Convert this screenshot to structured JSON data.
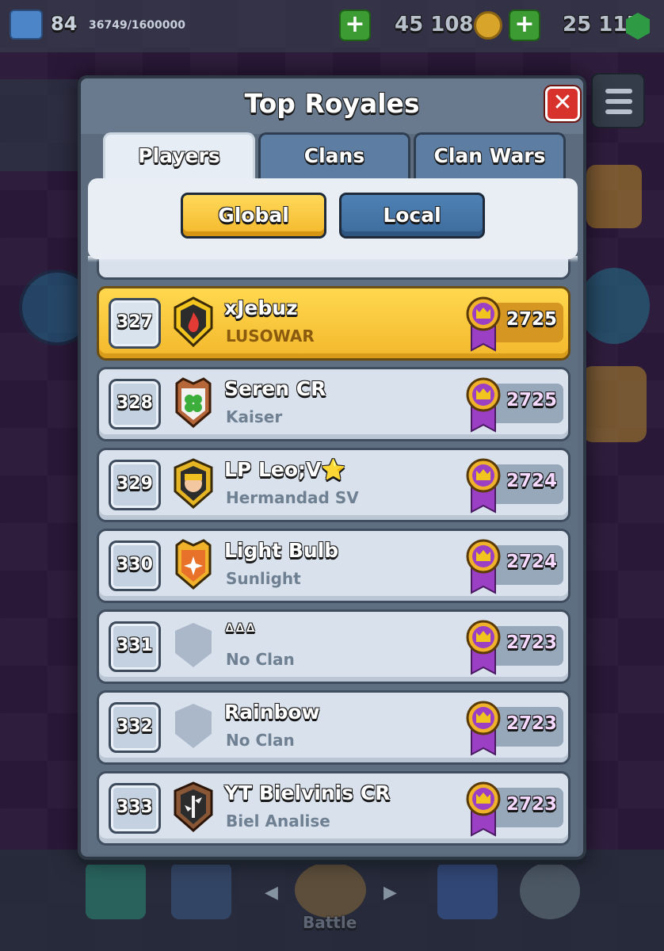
{
  "topbar": {
    "level": "84",
    "xp": "36749/1600000",
    "gold": "45 108",
    "gems": "25 117",
    "plus_label": "+"
  },
  "modal": {
    "title": "Top Royales",
    "close_label": "✕",
    "tabs": [
      {
        "label": "Players",
        "active": true
      },
      {
        "label": "Clans",
        "active": false
      },
      {
        "label": "Clan Wars",
        "active": false
      }
    ],
    "filters": {
      "global": "Global",
      "local": "Local",
      "selected": "Global"
    }
  },
  "rows": [
    {
      "rank": "327",
      "name": "xJebuz",
      "clan": "LUSOWAR",
      "trophies": "2725",
      "highlight": true,
      "badge": "flame-badge-icon"
    },
    {
      "rank": "328",
      "name": "Seren CR",
      "clan": "Kaiser",
      "trophies": "2725",
      "highlight": false,
      "badge": "clover-badge-icon"
    },
    {
      "rank": "329",
      "name": "LP Leo;V⭐",
      "clan": "Hermandad SV",
      "trophies": "2724",
      "highlight": false,
      "badge": "knight-badge-icon"
    },
    {
      "rank": "330",
      "name": "Light Bulb",
      "clan": "Sunlight",
      "trophies": "2724",
      "highlight": false,
      "badge": "star-badge-icon"
    },
    {
      "rank": "331",
      "name": "ᐞᐞᐞ",
      "clan": "No Clan",
      "trophies": "2723",
      "highlight": false,
      "badge": "no-clan-badge-icon"
    },
    {
      "rank": "332",
      "name": "Rainbow",
      "clan": "No Clan",
      "trophies": "2723",
      "highlight": false,
      "badge": "no-clan-badge-icon"
    },
    {
      "rank": "333",
      "name": "YT Bielvinis CR",
      "clan": "Biel Analise",
      "trophies": "2723",
      "highlight": false,
      "badge": "bamboo-badge-icon"
    }
  ],
  "bottom_nav": {
    "battle_label": "Battle"
  },
  "colors": {
    "highlight_row": "#f6c33a",
    "row": "#d8e1ec",
    "trophy_medal": "#9b3fc4",
    "close": "#d8322d",
    "global_button": "#f4b82b",
    "local_button": "#3d6c9d"
  }
}
